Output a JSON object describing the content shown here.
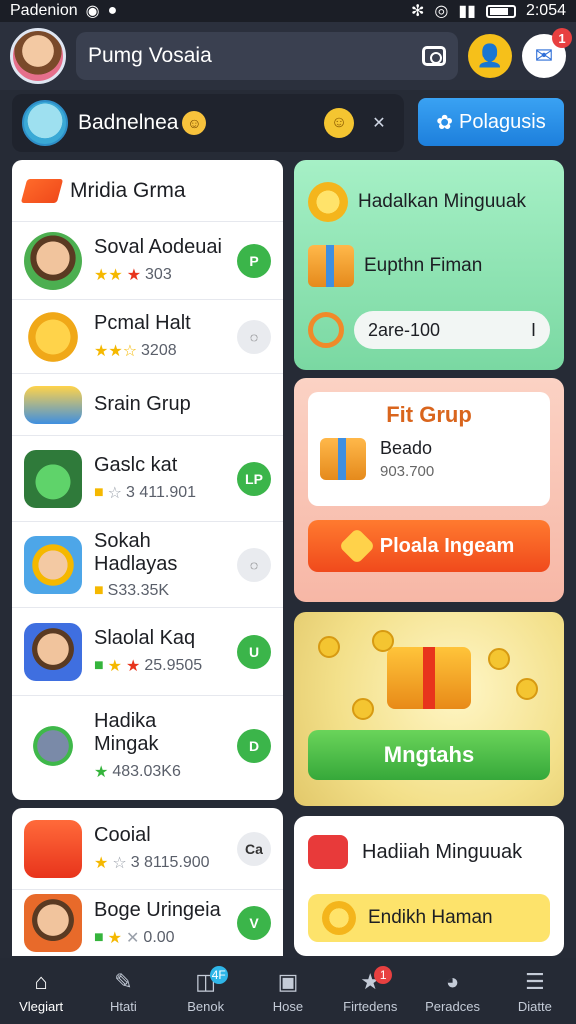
{
  "status": {
    "left_text": "Padenion",
    "time": "2:054"
  },
  "header": {
    "search_placeholder": "Pumg Vosaia",
    "mail_badge": "1"
  },
  "profile": {
    "name": "Badnelnea",
    "button_label": "Polagusis"
  },
  "left_panel": {
    "title": "Mridia Grma",
    "rows": [
      {
        "title": "Soval Aodeuai",
        "meta": "303",
        "action": "P"
      },
      {
        "title": "Pcmal Halt",
        "meta": "3208",
        "action": "◌"
      },
      {
        "title": "Srain Grup",
        "meta": "",
        "action": ""
      },
      {
        "title": "Gaslc kat",
        "meta": "3 411.901",
        "action": "LP"
      },
      {
        "title": "Sokah Hadlayas",
        "meta": "S33.35K",
        "action": "◌"
      },
      {
        "title": "Slaolal Kaq",
        "meta": "25.9505",
        "action": "U"
      },
      {
        "title": "Hadika Mingak",
        "meta": "483.03K6",
        "action": "D"
      }
    ]
  },
  "left_panel2": {
    "rows": [
      {
        "title": "Cooial",
        "meta": "3 8115.900",
        "action": "Ca"
      },
      {
        "title": "Boge Uringeia",
        "meta": "0.00",
        "action": "V"
      }
    ]
  },
  "card_green": {
    "row1": "Hadalkan Minguuak",
    "row2": "Eupthn Fiman",
    "pill_text": "2are-100",
    "pill_end": "I"
  },
  "card_pink": {
    "title": "Fit Grup",
    "item_title": "Beado",
    "item_value": "903.700",
    "button": "Ploala Ingeam"
  },
  "card_gold": {
    "button": "Mngtahs"
  },
  "card_white": {
    "row1": "Hadiiah Minguuak",
    "pill": "Endikh Haman"
  },
  "bottom_nav": [
    {
      "label": "Vlegiart",
      "icon": "⌂"
    },
    {
      "label": "Htati",
      "icon": "✎"
    },
    {
      "label": "Benok",
      "icon": "◫",
      "badge": "4F"
    },
    {
      "label": "Hose",
      "icon": "▣"
    },
    {
      "label": "Firtedens",
      "icon": "★",
      "badge": "1"
    },
    {
      "label": "Peradces",
      "icon": "◕"
    },
    {
      "label": "Diatte",
      "icon": "☰"
    }
  ],
  "colors": {
    "accent_blue": "#1d7fdc",
    "accent_green": "#3bb54a",
    "accent_orange": "#f04a1c",
    "bg_dark": "#262b36"
  }
}
